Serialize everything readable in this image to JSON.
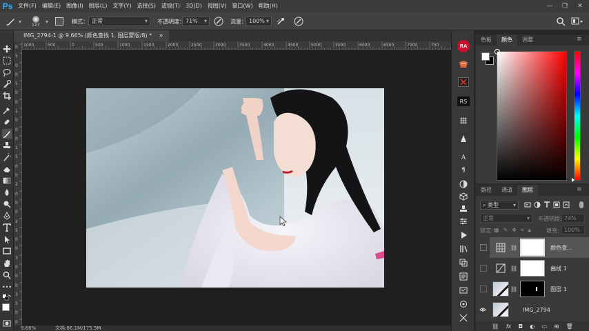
{
  "app": {
    "logo": "Ps"
  },
  "menubar": {
    "items": [
      "文件(F)",
      "编辑(E)",
      "图像(I)",
      "图层(L)",
      "文字(Y)",
      "选择(S)",
      "滤镜(T)",
      "3D(D)",
      "视图(V)",
      "窗口(W)",
      "帮助(H)"
    ]
  },
  "options": {
    "brush_size": "127",
    "mode_label": "模式：",
    "mode_value": "正常",
    "opacity_label": "不透明度：",
    "opacity_value": "71%",
    "flow_label": "流量：",
    "flow_value": "100%"
  },
  "document": {
    "tab_title": "IMG_2794-1 @ 9.66% (颜色查找 1, 图层蒙版/8) *",
    "close_glyph": "×",
    "zoom": "9.66%",
    "doc_info": "文档:86.1M/175.9M"
  },
  "rulers": {
    "h_ticks": [
      "1000",
      "500",
      "0",
      "500",
      "1000",
      "1500",
      "2000",
      "2500",
      "3000",
      "3500",
      "4000",
      "4500",
      "5000",
      "5500",
      "6000",
      "6500",
      "7000",
      "750"
    ],
    "v_ticks": [
      "0",
      "5",
      "0",
      "0",
      "5",
      "0",
      "0",
      "1",
      "0",
      "0",
      "0",
      "1",
      "5",
      "0",
      "0",
      "2",
      "0",
      "0",
      "0",
      "2",
      "5",
      "0",
      "0",
      "3",
      "0",
      "0",
      "0",
      "3",
      "5",
      "0",
      "0"
    ]
  },
  "color_panel": {
    "tabs": [
      "色板",
      "颜色",
      "调整"
    ],
    "active_tab": "颜色",
    "hue_color": "#ff0000"
  },
  "layers_panel": {
    "tabs": [
      "路径",
      "通道",
      "图层"
    ],
    "active_tab": "图层",
    "filter_label": "类型",
    "blend_mode": "正常",
    "opacity_label": "不透明度:",
    "opacity_value": "74%",
    "lock_label": "锁定:",
    "fill_label": "填充:",
    "fill_value": "100%",
    "layers": [
      {
        "name": "颜色查...",
        "selected": true
      },
      {
        "name": "曲线 1",
        "selected": false
      },
      {
        "name": "图层 1",
        "selected": false
      },
      {
        "name": "IMG_2794",
        "selected": false
      }
    ],
    "footer_icons": [
      "link-icon",
      "fx-icon",
      "mask-icon",
      "adjustment-icon",
      "folder-icon",
      "new-layer-icon",
      "trash-icon"
    ],
    "footer_fx": "fx"
  },
  "strip": {
    "ra": "RA",
    "rs": "RS",
    "char_icon": "A",
    "para_icon": "¶"
  }
}
